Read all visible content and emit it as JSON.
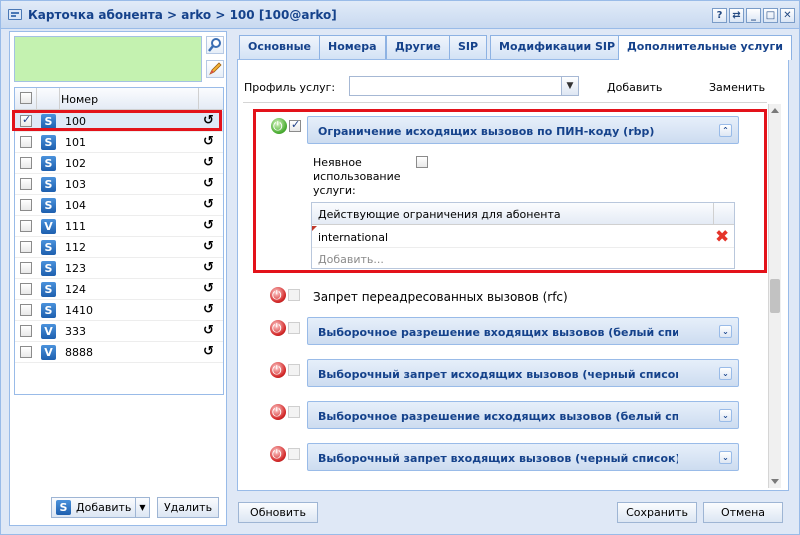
{
  "window": {
    "title": "Карточка абонента > arko > 100 [100@arko]",
    "tools": [
      "?",
      "⇄",
      "_",
      "□",
      "✕"
    ]
  },
  "left": {
    "grid": {
      "header": "Номер",
      "rows": [
        {
          "number": "100",
          "type": "S",
          "checked": true
        },
        {
          "number": "101",
          "type": "S",
          "checked": false
        },
        {
          "number": "102",
          "type": "S",
          "checked": false
        },
        {
          "number": "103",
          "type": "S",
          "checked": false
        },
        {
          "number": "104",
          "type": "S",
          "checked": false
        },
        {
          "number": "111",
          "type": "V",
          "checked": false
        },
        {
          "number": "112",
          "type": "S",
          "checked": false
        },
        {
          "number": "123",
          "type": "S",
          "checked": false
        },
        {
          "number": "124",
          "type": "S",
          "checked": false
        },
        {
          "number": "1410",
          "type": "S",
          "checked": false
        },
        {
          "number": "333",
          "type": "V",
          "checked": false
        },
        {
          "number": "8888",
          "type": "V",
          "checked": false
        }
      ]
    },
    "add_button": "Добавить",
    "delete_button": "Удалить"
  },
  "tabs": [
    {
      "label": "Основные"
    },
    {
      "label": "Номера"
    },
    {
      "label": "Другие"
    },
    {
      "label": "SIP"
    },
    {
      "label": "Модификации SIP"
    },
    {
      "label": "Дополнительные услуги",
      "active": true
    }
  ],
  "profile": {
    "label": "Профиль услуг:",
    "value": "",
    "add": "Добавить",
    "replace": "Заменить"
  },
  "services": {
    "rbp": {
      "title": "Ограничение исходящих вызовов по ПИН-коду (rbp)",
      "implicit_label": "Неявное использование услуги:",
      "grid_header": "Действующие ограничения для абонента",
      "restriction": "international",
      "add_placeholder": "Добавить..."
    },
    "rfc": "Запрет переадресованных вызовов (rfc)",
    "bars": [
      "Выборочное разрешение входящих вызовов (белый список) (",
      "Выборочный запрет исходящих вызовов (черный список) (sco",
      "Выборочное разрешение исходящих вызовов (белый список)",
      "Выборочный запрет входящих вызовов (черный список) (scr)"
    ]
  },
  "footer": {
    "refresh": "Обновить",
    "save": "Сохранить",
    "cancel": "Отмена"
  },
  "colors": {
    "accent": "#15428b",
    "highlight": "#e3121a",
    "green_panel": "#c4f2b0"
  }
}
